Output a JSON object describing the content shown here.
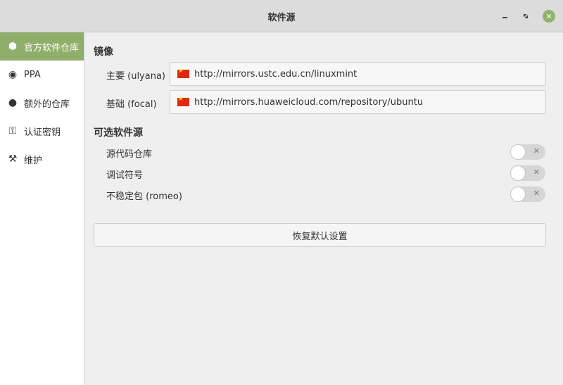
{
  "window": {
    "title": "软件源"
  },
  "sidebar": {
    "items": [
      {
        "label": "官方软件仓库",
        "icon": "package-icon"
      },
      {
        "label": "PPA",
        "icon": "radio-icon"
      },
      {
        "label": "额外的仓库",
        "icon": "globe-icon"
      },
      {
        "label": "认证密钥",
        "icon": "key-icon"
      },
      {
        "label": "维护",
        "icon": "tools-icon"
      }
    ]
  },
  "mirrors": {
    "heading": "镜像",
    "main": {
      "label": "主要 (ulyana)",
      "url": "http://mirrors.ustc.edu.cn/linuxmint"
    },
    "base": {
      "label": "基础 (focal)",
      "url": "http://mirrors.huaweicloud.com/repository/ubuntu"
    }
  },
  "optional": {
    "heading": "可选软件源",
    "items": [
      {
        "label": "源代码仓库",
        "enabled": false
      },
      {
        "label": "调试符号",
        "enabled": false
      },
      {
        "label": "不稳定包 (romeo)",
        "enabled": false
      }
    ]
  },
  "reset_label": "恢复默认设置",
  "colors": {
    "accent": "#8fae6a"
  }
}
